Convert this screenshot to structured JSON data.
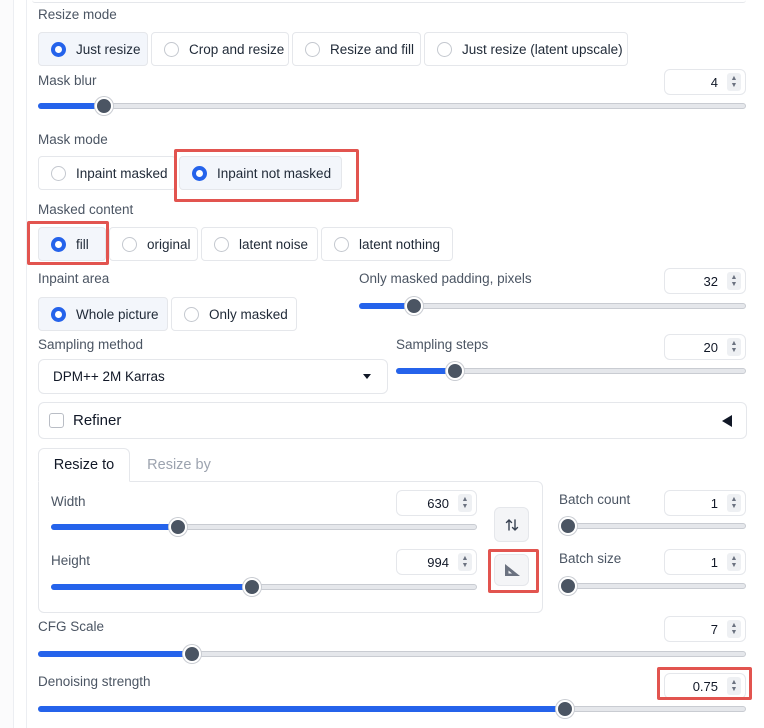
{
  "resize_mode": {
    "label": "Resize mode",
    "options": [
      "Just resize",
      "Crop and resize",
      "Resize and fill",
      "Just resize (latent upscale)"
    ],
    "selected": "Just resize"
  },
  "mask_blur": {
    "label": "Mask blur",
    "value": "4",
    "min": 0,
    "max": 64,
    "fraction": 0.083
  },
  "mask_mode": {
    "label": "Mask mode",
    "options": [
      "Inpaint masked",
      "Inpaint not masked"
    ],
    "selected": "Inpaint not masked"
  },
  "masked_content": {
    "label": "Masked content",
    "options": [
      "fill",
      "original",
      "latent noise",
      "latent nothing"
    ],
    "selected": "fill"
  },
  "inpaint_area": {
    "label": "Inpaint area",
    "options": [
      "Whole picture",
      "Only masked"
    ],
    "selected": "Whole picture"
  },
  "only_masked_padding": {
    "label": "Only masked padding, pixels",
    "value": "32",
    "min": 0,
    "max": 256,
    "fraction": 0.125
  },
  "sampling_method": {
    "label": "Sampling method",
    "value": "DPM++ 2M Karras"
  },
  "sampling_steps": {
    "label": "Sampling steps",
    "value": "20",
    "min": 1,
    "max": 150,
    "fraction": 0.15
  },
  "refiner": {
    "label": "Refiner",
    "checked": false
  },
  "tabs": {
    "resize_to": "Resize to",
    "resize_by": "Resize by",
    "active": "Resize to"
  },
  "width": {
    "label": "Width",
    "value": "630",
    "min": 64,
    "max": 2048,
    "fraction": 0.29
  },
  "height": {
    "label": "Height",
    "value": "994",
    "min": 64,
    "max": 2048,
    "fraction": 0.47
  },
  "swap_icon": "swap-vertical-arrows-icon",
  "ratio_icon": "set-square-ruler-icon",
  "batch_count": {
    "label": "Batch count",
    "value": "1",
    "min": 1,
    "max": 100,
    "fraction": 0.0
  },
  "batch_size": {
    "label": "Batch size",
    "value": "1",
    "min": 1,
    "max": 8,
    "fraction": 0.0
  },
  "cfg_scale": {
    "label": "CFG Scale",
    "value": "7",
    "min": 1,
    "max": 30,
    "fraction": 0.21
  },
  "denoising_strength": {
    "label": "Denoising strength",
    "value": "0.75",
    "min": 0,
    "max": 1,
    "fraction": 0.75
  },
  "colors": {
    "accent": "#2563eb",
    "highlight": "#e2544f",
    "border": "#e5e7eb",
    "thumb": "#4b5563"
  }
}
